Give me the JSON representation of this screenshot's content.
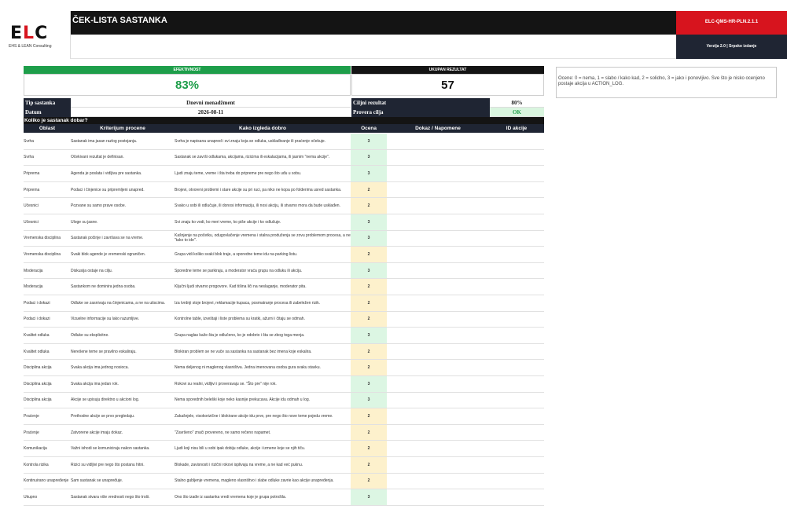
{
  "header": {
    "logo": "ELC",
    "logo_sub": "EHS & LEAN Consulting",
    "title": "ČEK-LISTA SASTANKA",
    "doc_code": "ELC-QMS-HR-PLN.2.1.1",
    "version": "Verzija 2.0 | Srpsko izdanje"
  },
  "summary": {
    "eff_label": "EFEKTIVNOST",
    "eff_value": "83%",
    "total_label": "UKUPAN REZULTAT",
    "total_value": "57"
  },
  "note": "Ocene: 0 = nema, 1 = slabo / kako kad, 2 = solidno, 3 = jako i ponovljivo. Sve što je nisko ocenjeno postaje akcija u ACTION_LOG.",
  "info": {
    "type_label": "Tip sastanka",
    "type_value": "Dnevni menadžment",
    "date_label": "Datum",
    "date_value": "2026-08-11",
    "target_label": "Ciljni rezultat",
    "target_value": "80%",
    "check_label": "Provera cilja",
    "check_value": "OK"
  },
  "question": "Koliko je sastanak dobar?",
  "columns": [
    "Oblast",
    "Kriterijum procene",
    "Kako izgleda dobro",
    "Ocena",
    "Dokaz / Napomene",
    "ID akcije"
  ],
  "colors": {
    "green": "#1e9e4a",
    "red": "#d7141e",
    "navy": "#1f2533",
    "score_high_bg": "#dcf6e3",
    "score_mid_bg": "#fdf1cc"
  },
  "rows": [
    {
      "area": "Svrha",
      "criterion": "Sastanak ima jasan razlog postojanja.",
      "good": "Svrha je napisana unapred i svi znaju koja se odluka, usklađivanje ili praćenje očekuje.",
      "score": "3"
    },
    {
      "area": "Svrha",
      "criterion": "Očekivani rezultat je definisan.",
      "good": "Sastanak se završi odlukama, akcijama, rizicima ili eskalacijama, ili jasnim \"nema akcije\".",
      "score": "3"
    },
    {
      "area": "Priprema",
      "criterion": "Agenda je poslata i vidljiva pre sastanka.",
      "good": "Ljudi znaju teme, vreme i šta treba do pripreme pre nego što uđu u sobu.",
      "score": "3"
    },
    {
      "area": "Priprema",
      "criterion": "Podaci i činjenice su pripremljeni unapred.",
      "good": "Brojevi, otvoreni problemi i stare akcije su pri ruci, pa niko ne kopa po folderima usred sastanka.",
      "score": "2"
    },
    {
      "area": "Učesnici",
      "criterion": "Pozvane su samo prave osobe.",
      "good": "Svako u sobi ili odlučuje, ili donosi informaciju, ili nosi akciju, ili stvarno mora da bude usklađen.",
      "score": "2"
    },
    {
      "area": "Učesnici",
      "criterion": "Uloge su jasne.",
      "good": "Svi znaju ko vodi, ko meri vreme, ko piše akcije i ko odlučuje.",
      "score": "3"
    },
    {
      "area": "Vremenska disciplina",
      "criterion": "Sastanak počinje i završava se na vreme.",
      "good": "Kašnjenje na početku, odugovlačenje vremena i stalna produženja se zovu problemom procesa, a ne \"tako to ide\".",
      "score": "3"
    },
    {
      "area": "Vremenska disciplina",
      "criterion": "Svaki blok agende je vremenski ograničen.",
      "good": "Grupa vidi koliko svaki blok traje, a sporedne teme idu na parking listu.",
      "score": "2"
    },
    {
      "area": "Moderacija",
      "criterion": "Diskusija ostaje na cilju.",
      "good": "Sporedne teme se parkiraju, a moderator vraća grupu na odluku ili akciju.",
      "score": "3"
    },
    {
      "area": "Moderacija",
      "criterion": "Sastankom ne dominira jedna osoba.",
      "good": "Ključni ljudi stvarno progovore. Kad tišina liči na neslaganje, moderator pita.",
      "score": "2"
    },
    {
      "area": "Podaci i dokazi",
      "criterion": "Odluke se zasnivaju na činjenicama, a ne na utiscima.",
      "good": "Iza tvrdnji stoje brojevi, reklamacije kupaca, posmatranje procesa ili zabeležen rizik.",
      "score": "2"
    },
    {
      "area": "Podaci i dokazi",
      "criterion": "Vizuelne informacije su lako razumljive.",
      "good": "Kontrolne table, izveštaji i liste problema su kratki, ažurni i čitaju se odmah.",
      "score": "2"
    },
    {
      "area": "Kvalitet odluka",
      "criterion": "Odluke su eksplicitne.",
      "good": "Grupa naglas kaže šta je odlučeno, ko je odobrio i šta se zbog toga menja.",
      "score": "3"
    },
    {
      "area": "Kvalitet odluka",
      "criterion": "Nerešene teme se pravilno eskaliraju.",
      "good": "Blokiran problem se ne vuče sa sastanka na sastanak bez imena koje eskalira.",
      "score": "2"
    },
    {
      "area": "Disciplina akcija",
      "criterion": "Svaka akcija ima jednog nosioca.",
      "good": "Nema deljenog ni maglenog vlasništva. Jedna imenovana osoba gura svaku stavku.",
      "score": "2"
    },
    {
      "area": "Disciplina akcija",
      "criterion": "Svaka akcija ima jedan rok.",
      "good": "Rokovi su realni, vidljivi i proveravaju se. \"Što pre\" nije rok.",
      "score": "3"
    },
    {
      "area": "Disciplina akcija",
      "criterion": "Akcije se upisuju direktno u akcioni log.",
      "good": "Nema sporednih beleški koje neko kasnije prekucava. Akcije idu odmah u log.",
      "score": "3"
    },
    {
      "area": "Praćenje",
      "criterion": "Prethodne akcije se prvo pregledaju.",
      "good": "Zakašnjele, visokorizične i blokirane akcije idu prve, pre nego što nove teme pojedu vreme.",
      "score": "2"
    },
    {
      "area": "Praćenje",
      "criterion": "Zatvorene akcije imaju dokaz.",
      "good": "\"Završeno\" znači provereno, ne samo rečeno napamet.",
      "score": "2"
    },
    {
      "area": "Komunikacija",
      "criterion": "Važni ishodi se komuniciraju nakon sastanka.",
      "good": "Ljudi koji nisu bili u sobi ipak dobiju odluke, akcije i izmene koje se njih tiču.",
      "score": "2"
    },
    {
      "area": "Kontrola rizika",
      "criterion": "Rizici su vidljivi pre nego što postanu hitni.",
      "good": "Blokade, zavisnosti i rizični rokovi isplivaju na vreme, a ne kad već puknu.",
      "score": "2"
    },
    {
      "area": "Kontinuirano unapređenje",
      "criterion": "Sam sastanak se unapređuje.",
      "good": "Stalno gubljenje vremena, magleno vlasništvo i slabe odluke zavrie kao akcije unapređenja.",
      "score": "2"
    },
    {
      "area": "Ukupno",
      "criterion": "Sastanak stvara više vrednosti nego što troši.",
      "good": "Ono što izađe iz sastanka vredi vremena koje je grupa potrošila.",
      "score": "3"
    }
  ]
}
